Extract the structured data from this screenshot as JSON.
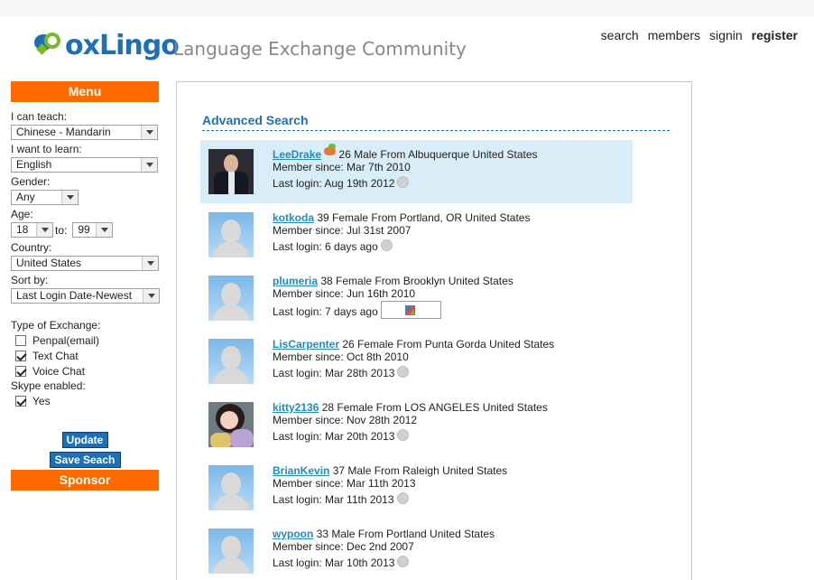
{
  "brand": {
    "name": "oxLingo",
    "tagline": "Language Exchange Community"
  },
  "topnav": [
    {
      "label": "search"
    },
    {
      "label": "members"
    },
    {
      "label": "signin"
    },
    {
      "label": "register"
    }
  ],
  "sidebar": {
    "menu_title": "Menu",
    "teach_label": "I can teach:",
    "teach_value": "Chinese - Mandarin",
    "learn_label": "I want to learn:",
    "learn_value": "English",
    "gender_label": "Gender:",
    "gender_value": "Any",
    "age_label": "Age:",
    "age_from": "18",
    "age_to_label": "to:",
    "age_to": "99",
    "country_label": "Country:",
    "country_value": "United States",
    "sort_label": "Sort by:",
    "sort_value": "Last Login Date-Newest",
    "exchange_label": "Type of Exchange:",
    "exchange_options": [
      {
        "label": "Penpal(email)",
        "checked": false
      },
      {
        "label": "Text Chat",
        "checked": true
      },
      {
        "label": "Voice Chat",
        "checked": true
      }
    ],
    "skype_label": "Skype enabled:",
    "skype_option": {
      "label": "Yes",
      "checked": true
    },
    "update_label": "Update",
    "save_label": "Save Seach",
    "sponsor_title": "Sponsor"
  },
  "main": {
    "title": "Advanced Search",
    "members": [
      {
        "username": "LeeDrake",
        "details": "26 Male From Albuquerque United States",
        "since": "Member since: Mar 7th 2010",
        "login": "Last login: Aug 19th 2012",
        "photo": "man-photo",
        "highlight": true
      },
      {
        "username": "kotkoda",
        "details": "39 Female From Portland, OR United States",
        "since": "Member since: Jul 31st 2007",
        "login": "Last login: 6 days ago",
        "photo": "default-avatar",
        "highlight": false
      },
      {
        "username": "plumeria",
        "details": "38 Female From Brooklyn United States",
        "since": "Member since: Jun 16th 2010",
        "login": "Last login: 7 days ago",
        "photo": "default-avatar",
        "highlight": false
      },
      {
        "username": "LisCarpenter",
        "details": "26 Female From Punta Gorda United States",
        "since": "Member since: Oct 8th 2010",
        "login": "Last login: Mar 28th 2013",
        "photo": "default-avatar",
        "highlight": false
      },
      {
        "username": "kitty2136",
        "details": "28 Female From LOS ANGELES United States",
        "since": "Member since: Nov 28th 2012",
        "login": "Last login: Mar 20th 2013",
        "photo": "girl-photo",
        "highlight": false
      },
      {
        "username": "BrianKevin",
        "details": "37 Male From Raleigh United States",
        "since": "Member since: Mar 11th 2013",
        "login": "Last login: Mar 11th 2013",
        "photo": "default-avatar",
        "highlight": false
      },
      {
        "username": "wypoon",
        "details": "33 Male From Portland United States",
        "since": "Member since: Dec 2nd 2007",
        "login": "Last login: Mar 10th 2013",
        "photo": "default-avatar",
        "highlight": false
      }
    ]
  },
  "colors": {
    "accent": "#ff6a00",
    "brand_blue": "#1e6fb5",
    "link": "#1e8bc3",
    "highlight_row": "#d8edf8"
  }
}
